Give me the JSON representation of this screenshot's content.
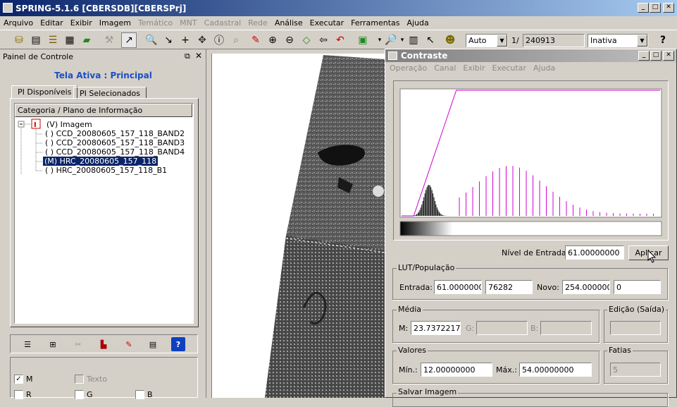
{
  "window": {
    "title": "SPRING-5.1.6 [CBERSDB][CBERSPrj]"
  },
  "menu": [
    {
      "label": "Arquivo",
      "enabled": true
    },
    {
      "label": "Editar",
      "enabled": true
    },
    {
      "label": "Exibir",
      "enabled": true
    },
    {
      "label": "Imagem",
      "enabled": true
    },
    {
      "label": "Temático",
      "enabled": false
    },
    {
      "label": "MNT",
      "enabled": false
    },
    {
      "label": "Cadastral",
      "enabled": false
    },
    {
      "label": "Rede",
      "enabled": false
    },
    {
      "label": "Análise",
      "enabled": true
    },
    {
      "label": "Executar",
      "enabled": true
    },
    {
      "label": "Ferramentas",
      "enabled": true
    },
    {
      "label": "Ajuda",
      "enabled": true
    }
  ],
  "toolbar": {
    "scale_mode": "Auto",
    "scale_prefix": "1/",
    "scale_value": "240913",
    "status_combo": "Inativa",
    "help": "?"
  },
  "control_panel": {
    "title": "Painel de Controle",
    "active_screen": "Tela Ativa : Principal",
    "tabs": [
      "PI Disponíveis",
      "PI Selecionados"
    ],
    "tree_header": "Categoria / Plano de Informação",
    "category": "(V) Imagem",
    "items": [
      "( ) CCD_20080605_157_118_BAND2",
      "( ) CCD_20080605_157_118_BAND3",
      "( ) CCD_20080605_157_118_BAND4",
      "(M) HRC_20080605_157_118",
      "( ) HRC_20080605_157_118_B1"
    ],
    "selected_index": 3,
    "checks": [
      {
        "label": "M",
        "checked": true,
        "enabled": true
      },
      {
        "label": "Texto",
        "checked": false,
        "enabled": false
      },
      {
        "label": "R",
        "checked": false,
        "enabled": true
      },
      {
        "label": "G",
        "checked": false,
        "enabled": true
      },
      {
        "label": "B",
        "checked": false,
        "enabled": true
      }
    ]
  },
  "contrast": {
    "title": "Contraste",
    "menu": [
      "Operação",
      "Canal",
      "Exibir",
      "Executar",
      "Ajuda"
    ],
    "nivel_label": "Nível de Entrada:",
    "nivel_value": "61.00000000",
    "apply": "Aplicar",
    "lut_label": "LUT/População",
    "entrada_label": "Entrada:",
    "entrada_value": "61.00000000",
    "entrada_pop": "76282",
    "novo_label": "Novo:",
    "novo_value": "254.00000000",
    "novo_pop": "0",
    "media_label": "Média",
    "m_label": "M:",
    "m_value": "23.73722172",
    "g_label": "G:",
    "b_label": "B:",
    "edicao_label": "Edição (Saída)",
    "valores_label": "Valores",
    "min_label": "Mín.:",
    "min_value": "12.00000000",
    "max_label": "Máx.:",
    "max_value": "54.00000000",
    "fatias_label": "Fatias",
    "fatias_value": "5",
    "salvar_label": "Salvar Imagem"
  },
  "colors": {
    "title_active": "#0a246a",
    "title_inactive": "#808080",
    "lut_line": "#d000d0",
    "selection": "#0a246a",
    "tela_ativa": "#1c4fc4"
  }
}
